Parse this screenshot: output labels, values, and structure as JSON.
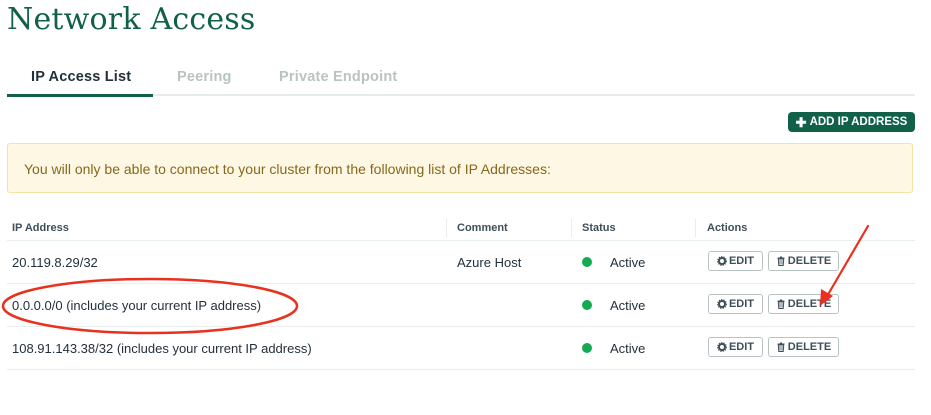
{
  "page": {
    "title": "Network Access"
  },
  "tabs": [
    {
      "label": "IP Access List",
      "active": true
    },
    {
      "label": "Peering",
      "active": false
    },
    {
      "label": "Private Endpoint",
      "active": false
    }
  ],
  "toolbar": {
    "add_ip_label": "ADD IP ADDRESS",
    "add_ip_icon": "plus-icon"
  },
  "banner": {
    "text": "You will only be able to connect to your cluster from the following list of IP Addresses:"
  },
  "table": {
    "headers": [
      "IP Address",
      "Comment",
      "Status",
      "Actions"
    ],
    "rows": [
      {
        "ip": "20.119.8.29/32",
        "comment": "Azure Host",
        "status": "Active"
      },
      {
        "ip": "0.0.0.0/0  (includes your current IP address)",
        "comment": "",
        "status": "Active"
      },
      {
        "ip": "108.91.143.38/32  (includes your current IP address)",
        "comment": "",
        "status": "Active"
      }
    ],
    "edit_label": "EDIT",
    "delete_label": "DELETE",
    "edit_icon": "gear-icon",
    "delete_icon": "trash-icon"
  },
  "colors": {
    "brand_green": "#116149",
    "status_active": "#13aa52",
    "banner_bg": "#fef7e3",
    "banner_text": "#86681d",
    "annotation_red": "#e8321f"
  }
}
